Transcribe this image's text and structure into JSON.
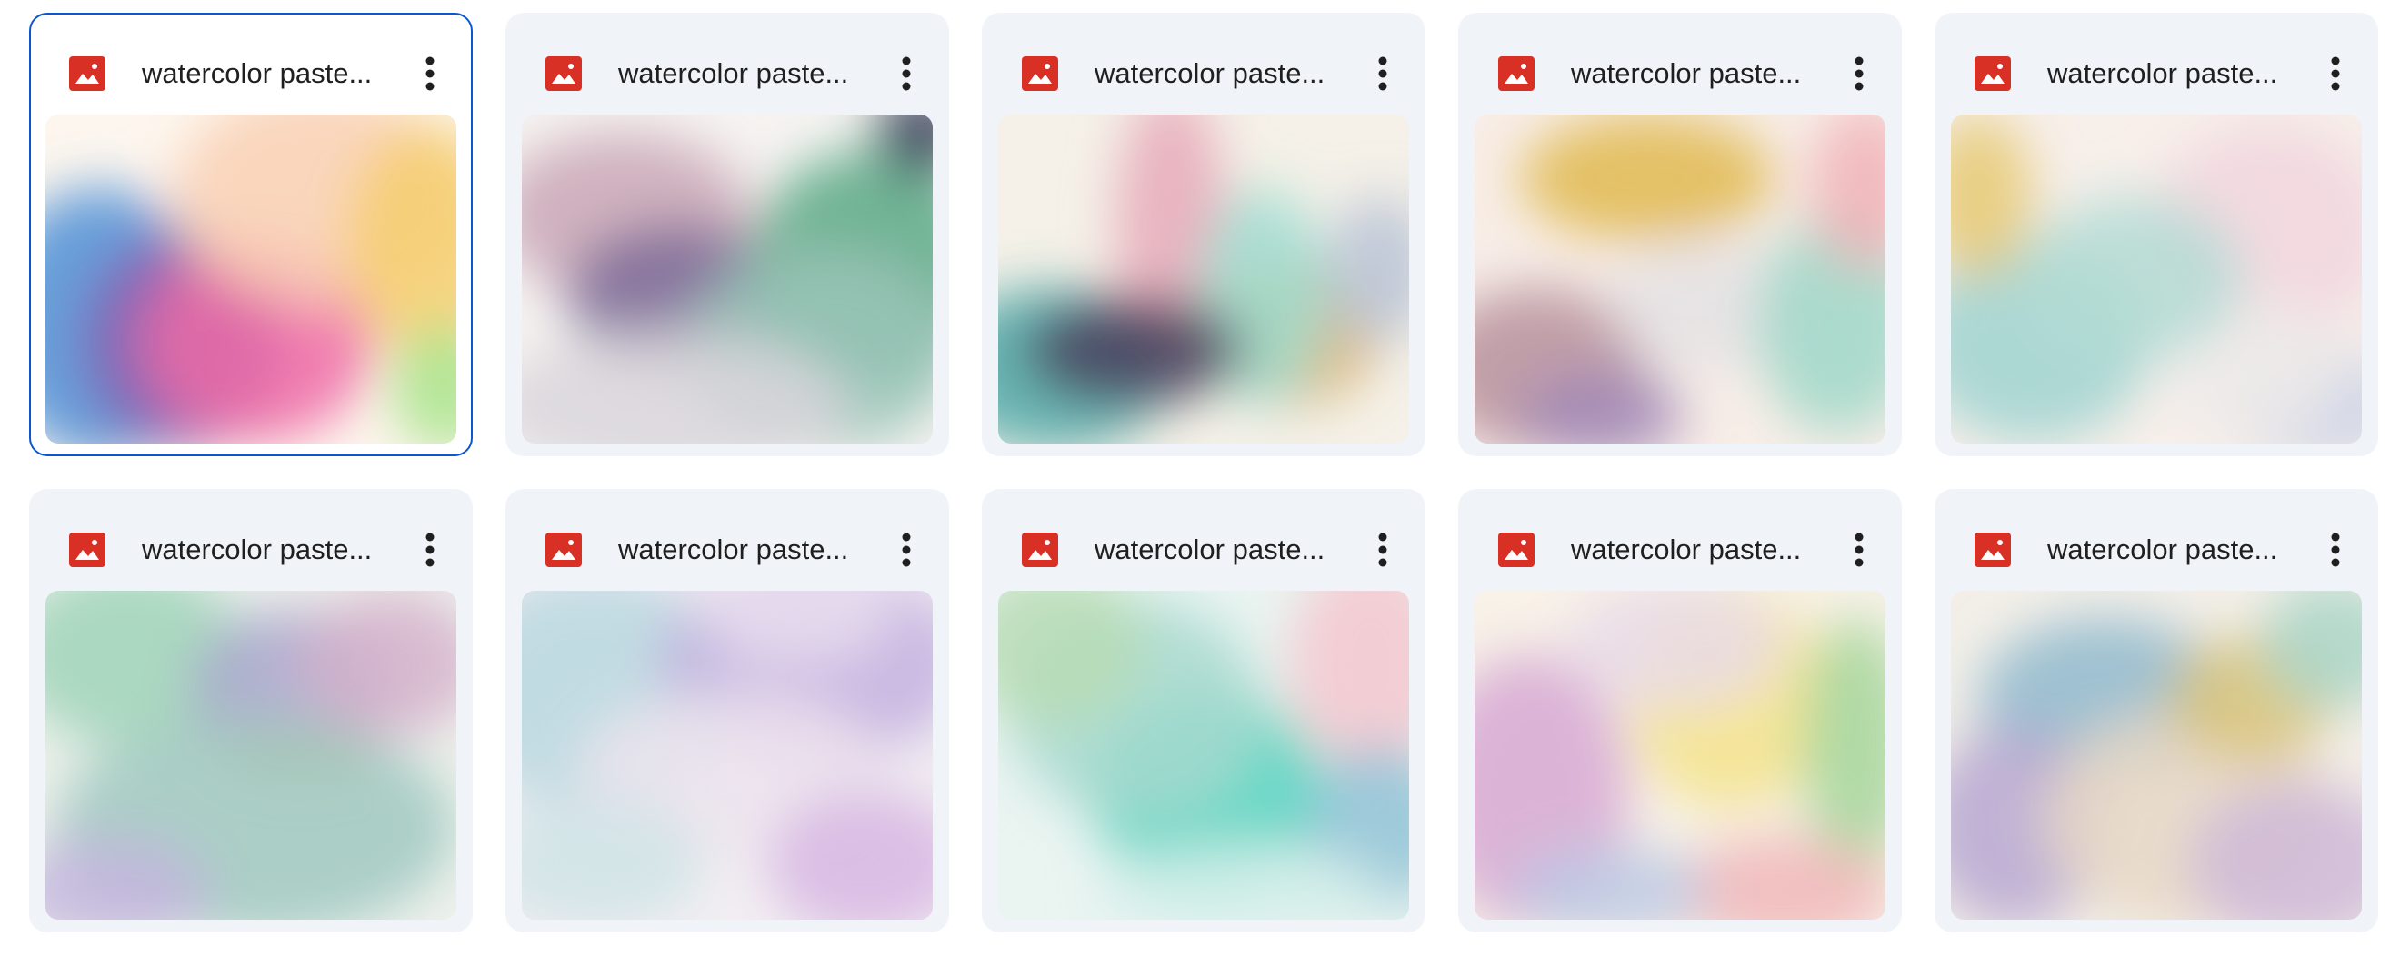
{
  "grid": {
    "items": [
      {
        "name": "watercolor paste...",
        "icon": "image-file-icon",
        "selected": true,
        "palette": [
          "#fdf6ee",
          "#4d8fd6",
          "#7d5fb0",
          "#ee6aa6",
          "#f9d0b4",
          "#f6cf6e",
          "#a8e48a"
        ]
      },
      {
        "name": "watercolor paste...",
        "icon": "image-file-icon",
        "selected": false,
        "palette": [
          "#f6f3f1",
          "#c9a7b6",
          "#7c6b98",
          "#5aa985",
          "#9bc5b8",
          "#d9d6dc",
          "#2f3552"
        ]
      },
      {
        "name": "watercolor paste...",
        "icon": "image-file-icon",
        "selected": false,
        "palette": [
          "#f5f1e8",
          "#e6a8b8",
          "#4fa9a8",
          "#d6b373",
          "#9fdcd0",
          "#4a3f5c",
          "#b9c3d6"
        ]
      },
      {
        "name": "watercolor paste...",
        "icon": "image-file-icon",
        "selected": false,
        "palette": [
          "#f8eee8",
          "#e0b84f",
          "#b7909c",
          "#e4e2e4",
          "#9ed7c8",
          "#f0b2b7",
          "#a28ab7"
        ]
      },
      {
        "name": "watercolor paste...",
        "icon": "image-file-icon",
        "selected": false,
        "palette": [
          "#f7efea",
          "#9fd3d0",
          "#e6c973",
          "#f1d6de",
          "#c9d2e6",
          "#eeebea",
          "#b4dcd5"
        ]
      },
      {
        "name": "watercolor paste...",
        "icon": "image-file-icon",
        "selected": false,
        "palette": [
          "#eef1ec",
          "#9fd3b8",
          "#a9a7cc",
          "#e5c38d",
          "#d5b2cb",
          "#9fc8c0",
          "#c4b6de"
        ]
      },
      {
        "name": "watercolor paste...",
        "icon": "image-file-icon",
        "selected": false,
        "palette": [
          "#f2eef2",
          "#b8d8df",
          "#c3b0df",
          "#ede4ee",
          "#d7b6e3",
          "#cfe4e6",
          "#e9dff0"
        ]
      },
      {
        "name": "watercolor paste...",
        "icon": "image-file-icon",
        "selected": false,
        "palette": [
          "#eaf4f1",
          "#54d3bf",
          "#a8d9cf",
          "#b9dcb5",
          "#f4c7cf",
          "#8fc2d6",
          "#d3efea"
        ]
      },
      {
        "name": "watercolor paste...",
        "icon": "image-file-icon",
        "selected": false,
        "palette": [
          "#f8f2e8",
          "#f3e38b",
          "#d6a8d4",
          "#a3d59a",
          "#f0b6b8",
          "#bcc9e4",
          "#e9dbe9"
        ]
      },
      {
        "name": "watercolor paste...",
        "icon": "image-file-icon",
        "selected": false,
        "palette": [
          "#f3efe8",
          "#8fb8cc",
          "#b7a7d1",
          "#e8d8c6",
          "#d9c47a",
          "#a9d5c7",
          "#cfb8d8"
        ]
      }
    ],
    "more_icon": "more-vert-icon"
  },
  "colors": {
    "card_background": "#f0f4f9",
    "selected_border": "#0b57d0",
    "image_icon_red": "#d93025",
    "text": "#1f1f1f",
    "more_icon": "#1f1f1f"
  }
}
